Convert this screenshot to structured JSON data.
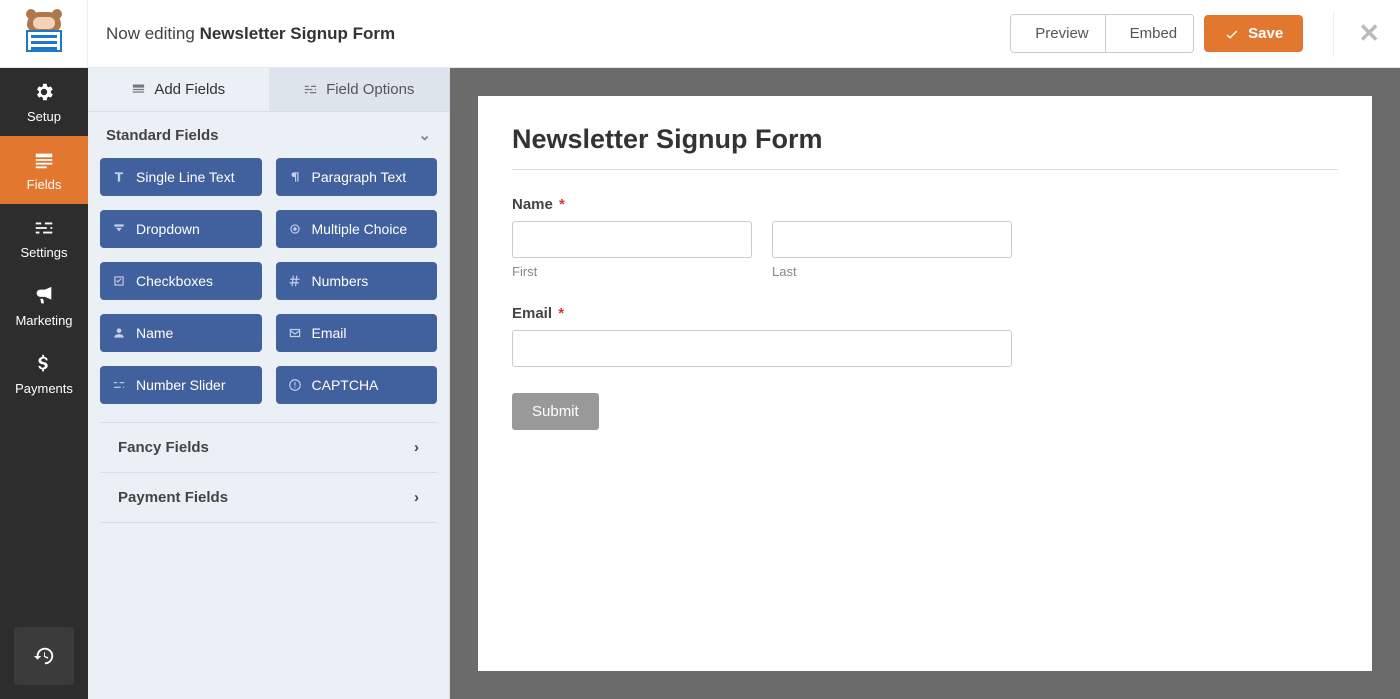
{
  "header": {
    "editing_prefix": "Now editing ",
    "form_name": "Newsletter Signup Form",
    "preview": "Preview",
    "embed": "Embed",
    "save": "Save"
  },
  "rail": {
    "setup": "Setup",
    "fields": "Fields",
    "settings": "Settings",
    "marketing": "Marketing",
    "payments": "Payments"
  },
  "panel": {
    "tab_add": "Add Fields",
    "tab_options": "Field Options",
    "group_standard": "Standard Fields",
    "group_fancy": "Fancy Fields",
    "group_payment": "Payment Fields",
    "fields": {
      "single_line": "Single Line Text",
      "paragraph": "Paragraph Text",
      "dropdown": "Dropdown",
      "multiple_choice": "Multiple Choice",
      "checkboxes": "Checkboxes",
      "numbers": "Numbers",
      "name": "Name",
      "email": "Email",
      "number_slider": "Number Slider",
      "captcha": "CAPTCHA"
    }
  },
  "form": {
    "title": "Newsletter Signup Form",
    "name_label": "Name",
    "first": "First",
    "last": "Last",
    "email_label": "Email",
    "submit": "Submit"
  }
}
